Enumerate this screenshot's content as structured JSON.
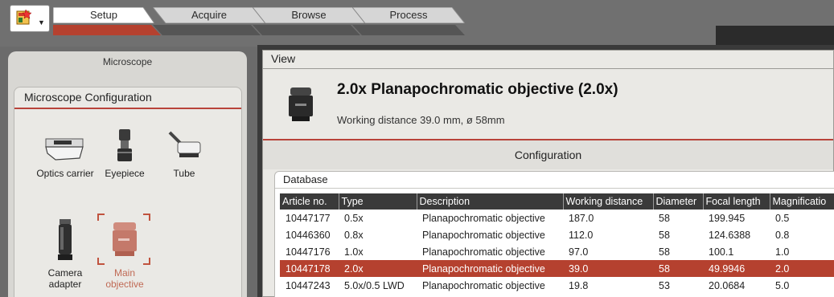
{
  "tabs": [
    {
      "label": "Setup",
      "active": true
    },
    {
      "label": "Acquire",
      "active": false
    },
    {
      "label": "Browse",
      "active": false
    },
    {
      "label": "Process",
      "active": false
    }
  ],
  "left_panel": {
    "title": "Microscope",
    "config_title": "Microscope Configuration",
    "items": [
      {
        "label": "Optics carrier",
        "icon": "optics-carrier-icon"
      },
      {
        "label": "Eyepiece",
        "icon": "eyepiece-icon"
      },
      {
        "label": "Tube",
        "icon": "tube-icon"
      },
      {
        "label": "Camera adapter",
        "icon": "camera-adapter-icon"
      },
      {
        "label": "Main objective",
        "icon": "main-objective-icon",
        "selected": true
      }
    ]
  },
  "view": {
    "title": "View",
    "objective_title": "2.0x Planapochromatic objective (2.0x)",
    "objective_subtitle": "Working distance 39.0 mm, ø 58mm",
    "configuration_label": "Configuration",
    "database_title": "Database",
    "columns": [
      "Article no.",
      "Type",
      "Description",
      "Working distance",
      "Diameter",
      "Focal length",
      "Magnificatio"
    ],
    "rows": [
      [
        "10447177",
        "0.5x",
        "Planapochromatic objective",
        "187.0",
        "58",
        "199.945",
        "0.5"
      ],
      [
        "10446360",
        "0.8x",
        "Planapochromatic objective",
        "112.0",
        "58",
        "124.6388",
        "0.8"
      ],
      [
        "10447176",
        "1.0x",
        "Planapochromatic objective",
        "97.0",
        "58",
        "100.1",
        "1.0"
      ],
      [
        "10447178",
        "2.0x",
        "Planapochromatic objective",
        "39.0",
        "58",
        "49.9946",
        "2.0"
      ],
      [
        "10447243",
        "5.0x/0.5 LWD",
        "Planapochromatic objective",
        "19.8",
        "53",
        "20.0684",
        "5.0"
      ]
    ],
    "selected_row": 3
  },
  "colors": {
    "accent": "#b5412f",
    "header_dark": "#3a3a3a",
    "panel_bg": "#eae9e5"
  }
}
